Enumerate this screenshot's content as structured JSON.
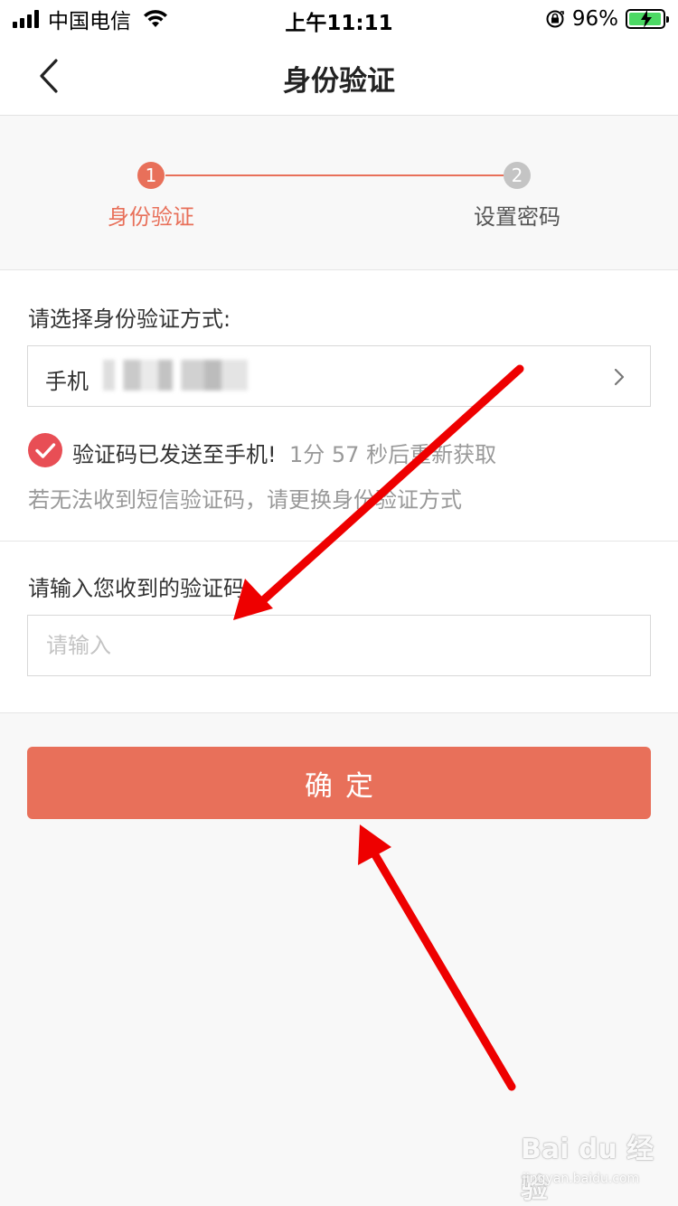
{
  "status_bar": {
    "carrier": "中国电信",
    "time": "上午11:11",
    "battery": "96%",
    "battery_level": 0.96
  },
  "nav": {
    "title": "身份验证",
    "back_icon": "chevron-left-icon"
  },
  "stepper": {
    "steps": [
      {
        "number": "1",
        "label": "身份验证",
        "active": true
      },
      {
        "number": "2",
        "label": "设置密码",
        "active": false
      }
    ]
  },
  "verify_method": {
    "label": "请选择身份验证方式:",
    "selected": "手机"
  },
  "sms_status": {
    "sent": "验证码已发送至手机!",
    "countdown": "1分 57 秒后重新获取",
    "hint": "若无法收到短信验证码，请更换身份验证方式"
  },
  "code_entry": {
    "label": "请输入您收到的验证码",
    "placeholder": "请输入",
    "value": ""
  },
  "confirm": {
    "label": "确定"
  },
  "watermark": {
    "logo": "Bai du 经验",
    "url": "jingyan.baidu.com"
  },
  "colors": {
    "accent": "#e8705a",
    "check": "#e84e55",
    "arrow": "#ee0000"
  }
}
